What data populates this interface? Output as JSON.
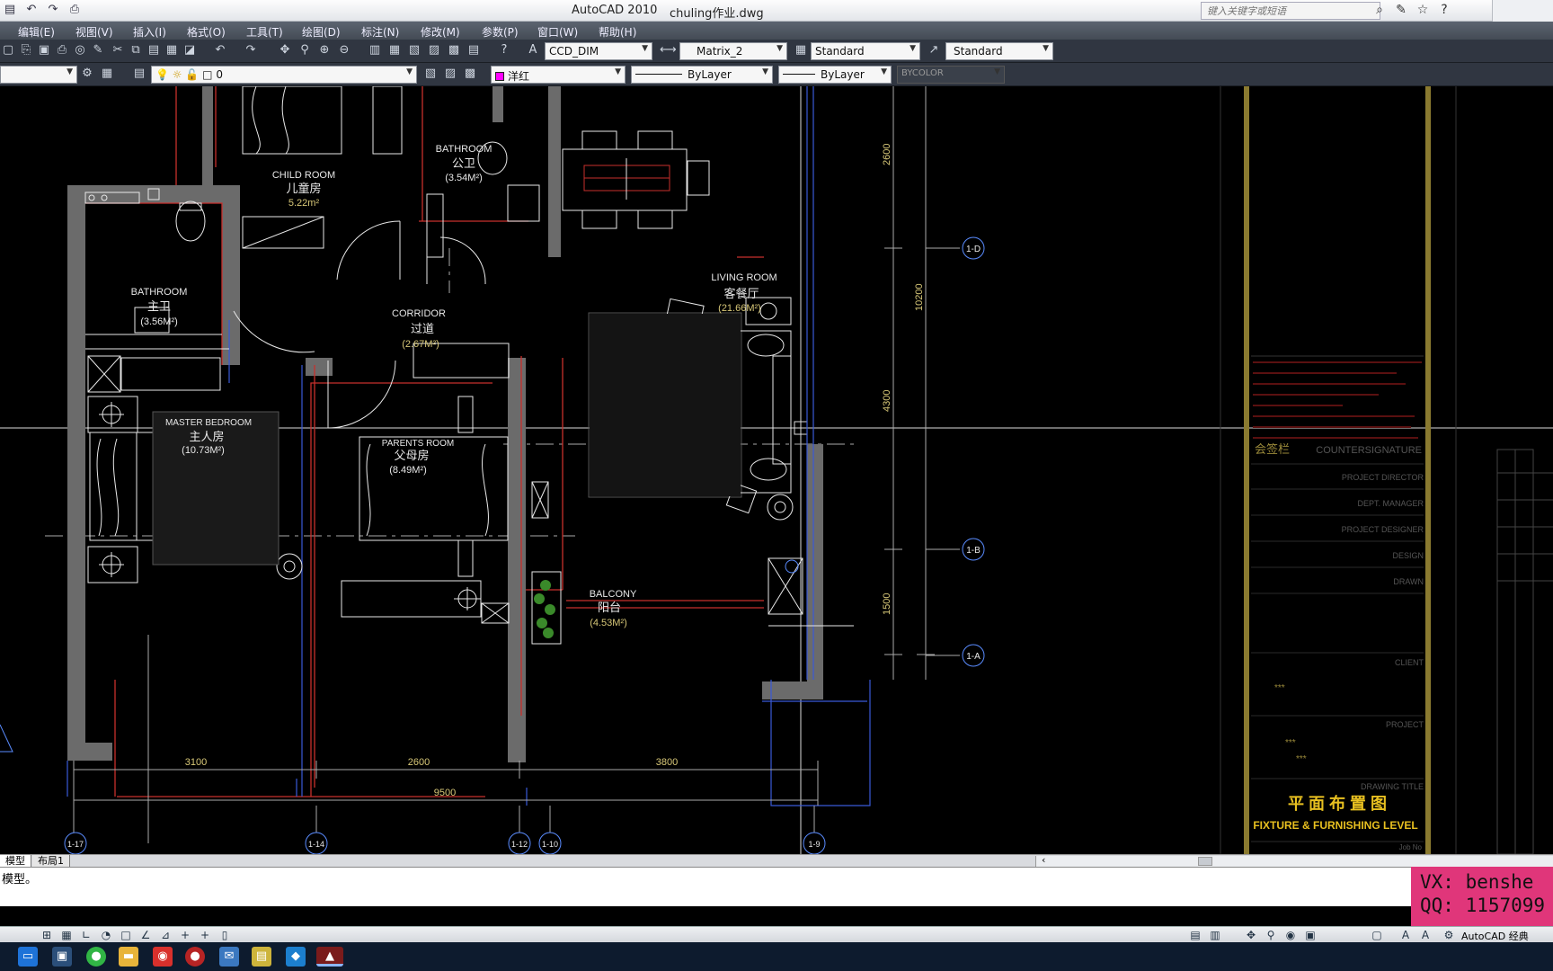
{
  "window": {
    "app_title": "AutoCAD 2010",
    "file_name": "chuling作业.dwg",
    "search_placeholder": "键入关键字或短语"
  },
  "menu": [
    "编辑(E)",
    "视图(V)",
    "插入(I)",
    "格式(O)",
    "工具(T)",
    "绘图(D)",
    "标注(N)",
    "修改(M)",
    "参数(P)",
    "窗口(W)",
    "帮助(H)"
  ],
  "toolbar": {
    "text_style": "CCD_DIM",
    "dim_style": "Matrix_2",
    "table_style": "Standard",
    "multileader_style": "Standard",
    "layer": "0",
    "color": "洋红",
    "linetype": "ByLayer",
    "lineweight": "ByLayer",
    "plot_style": "BYCOLOR"
  },
  "drawing": {
    "rooms": [
      {
        "en": "CHILD ROOM",
        "cn": "儿童房",
        "area": "5.22m²"
      },
      {
        "en": "BATHROOM",
        "cn": "公卫",
        "area": "(3.54M²)"
      },
      {
        "en": "BATHROOM",
        "cn": "主卫",
        "area": "(3.56M²)"
      },
      {
        "en": "CORRIDOR",
        "cn": "过道",
        "area": "(2.67M²)"
      },
      {
        "en": "LIVING ROOM",
        "cn": "客餐厅",
        "area": "(21.66M²)"
      },
      {
        "en": "MASTER BEDROOM",
        "cn": "主人房",
        "area": "(10.73M²)"
      },
      {
        "en": "PARENTS ROOM",
        "cn": "父母房",
        "area": "(8.49M²)"
      },
      {
        "en": "BALCONY",
        "cn": "阳台",
        "area": "(4.53M²)"
      }
    ],
    "dims_h": [
      "3100",
      "2600",
      "3800",
      "9500"
    ],
    "dims_v": [
      "2600",
      "10200",
      "4300",
      "1500"
    ],
    "grid_bubbles_v": [
      "1-D",
      "1-B",
      "1-A"
    ],
    "grid_bubbles_h": [
      "1-17",
      "1-14",
      "1-12",
      "1-10",
      "1-9"
    ],
    "titleblock": {
      "countersign_cn": "会签栏",
      "countersign_en": "COUNTERSIGNATURE",
      "roles": [
        "PROJECT DIRECTOR",
        "DEPT. MANAGER",
        "PROJECT DESIGNER",
        "DESIGN",
        "DRAWN",
        "CLIENT",
        "PROJECT",
        "DRAWING TITLE"
      ],
      "title_cn": "平 面 布 置 图",
      "title_en": "FIXTURE & FURNISHING LEVEL",
      "job_no": "Job No",
      "placeholder": "***"
    }
  },
  "tabs": {
    "model": "模型",
    "layout": "布局1"
  },
  "command": {
    "history": "模型。",
    "input": ""
  },
  "watermark": {
    "vx": "VX: benshe",
    "qq": "QQ: 1157099"
  },
  "status": {
    "workspace": "AutoCAD 经典"
  },
  "colors": {
    "wall_gray": "#6e6e6e",
    "wall_red": "#c8302c",
    "furniture": "#e8e8e8",
    "dim_yellow": "#d8c878",
    "titleblock_gold": "#9b8a3a",
    "bubble": "#5a8cff"
  }
}
